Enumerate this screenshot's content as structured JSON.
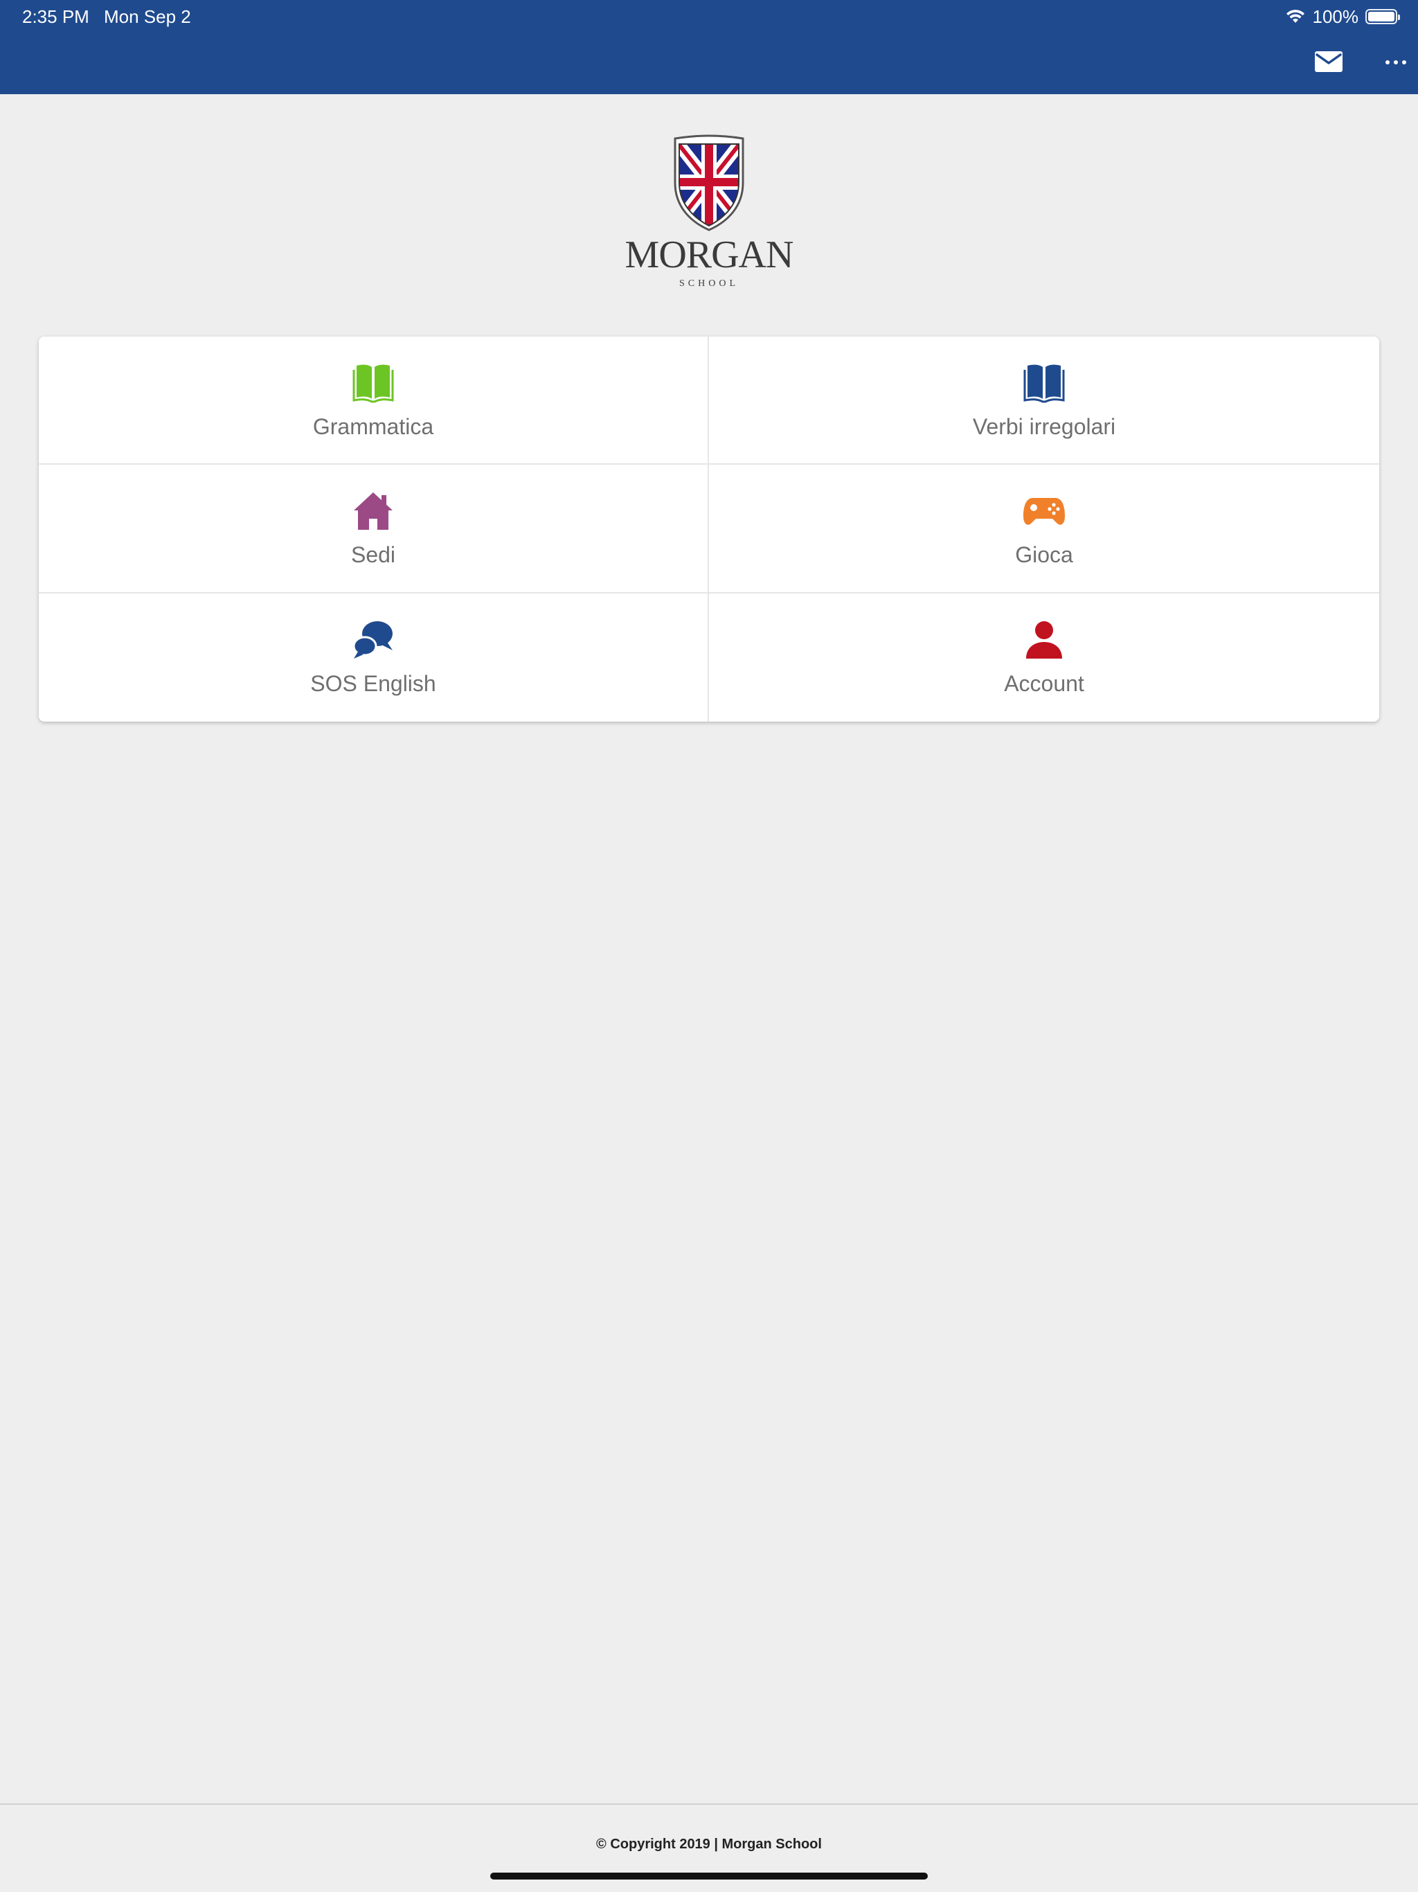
{
  "status_bar": {
    "time": "2:35 PM",
    "date": "Mon Sep 2",
    "battery": "100%",
    "battery_level": 1.0,
    "wifi_icon": "wifi-icon"
  },
  "header": {
    "mail_icon": "mail-icon",
    "more_icon": "more-horizontal-icon",
    "bar_color": "#1f4a8e"
  },
  "logo": {
    "name": "MORGAN",
    "sub": "SCHOOL"
  },
  "menu": [
    {
      "label": "Grammatica",
      "icon": "book-icon",
      "color": "#6cc524"
    },
    {
      "label": "Verbi irregolari",
      "icon": "book-icon",
      "color": "#1f4a8e"
    },
    {
      "label": "Sedi",
      "icon": "home-icon",
      "color": "#9b4a86"
    },
    {
      "label": "Gioca",
      "icon": "gamepad-icon",
      "color": "#f0802a"
    },
    {
      "label": "SOS English",
      "icon": "chat-bubbles-icon",
      "color": "#1f4a8e"
    },
    {
      "label": "Account",
      "icon": "user-icon",
      "color": "#c1121f"
    }
  ],
  "footer": {
    "copyright": "© Copyright 2019 | Morgan School"
  }
}
